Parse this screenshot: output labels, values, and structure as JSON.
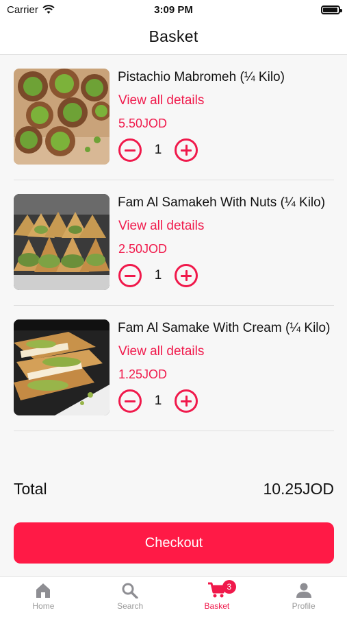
{
  "status": {
    "carrier": "Carrier",
    "time": "3:09 PM",
    "battery_level": 0.95
  },
  "header": {
    "title": "Basket"
  },
  "items": [
    {
      "name": "Pistachio Mabromeh (¼ Kilo)",
      "link": "View all details",
      "price": "5.50JOD",
      "qty": "1"
    },
    {
      "name": "Fam Al Samakeh With Nuts (¼ Kilo)",
      "link": "View all details",
      "price": "2.50JOD",
      "qty": "1"
    },
    {
      "name": "Fam Al Samake With Cream (¼ Kilo)",
      "link": "View all details",
      "price": "1.25JOD",
      "qty": "1"
    }
  ],
  "summary": {
    "total_label": "Total",
    "total_value": "10.25JOD"
  },
  "checkout": {
    "label": "Checkout"
  },
  "tabs": [
    {
      "label": "Home",
      "icon": "home-icon"
    },
    {
      "label": "Search",
      "icon": "search-icon"
    },
    {
      "label": "Basket",
      "icon": "cart-icon",
      "badge": "3",
      "active": true
    },
    {
      "label": "Profile",
      "icon": "person-icon"
    }
  ],
  "colors": {
    "accent": "#f0194b",
    "checkout_bg": "#ff1a46",
    "inactive_tab": "#9a9a9a"
  }
}
